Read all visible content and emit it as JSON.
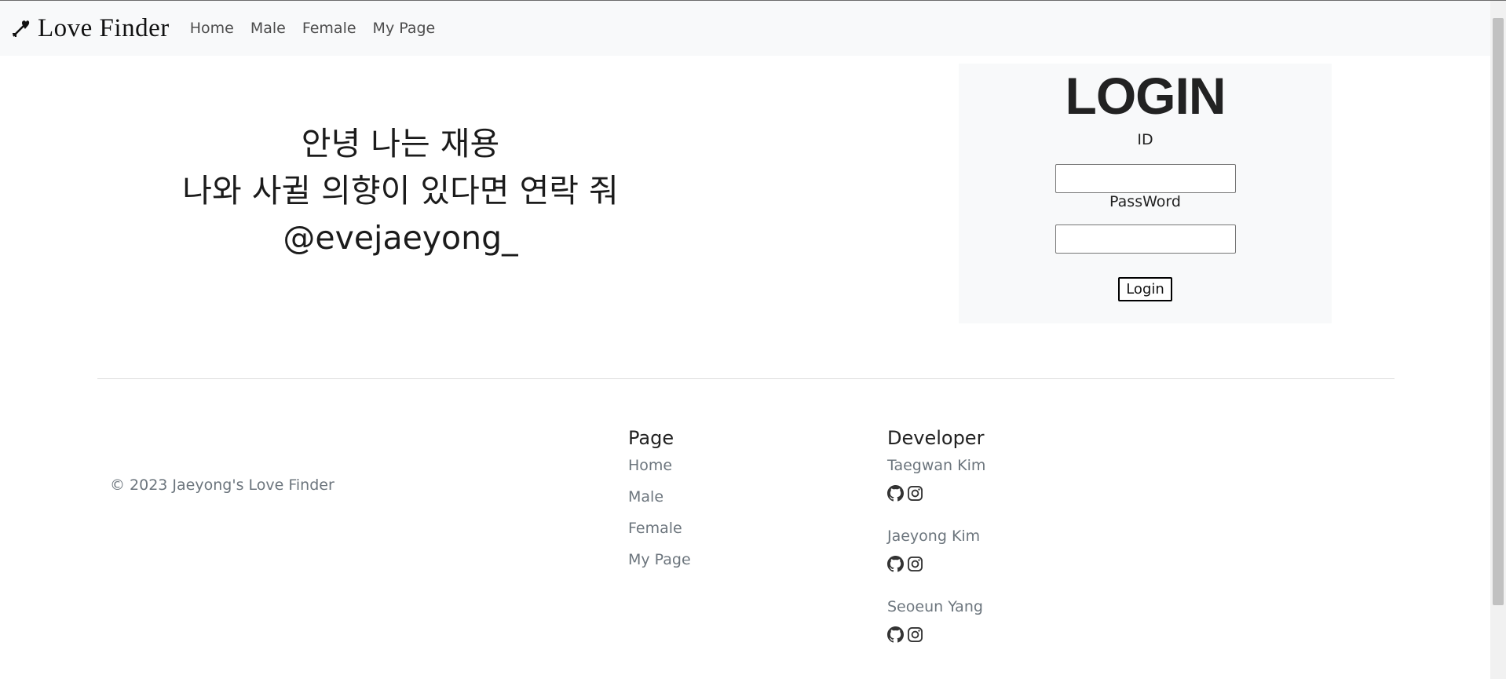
{
  "navbar": {
    "brand": "Love Finder",
    "links": [
      "Home",
      "Male",
      "Female",
      "My Page"
    ]
  },
  "hero": {
    "line1": "안녕 나는 재용",
    "line2": "나와 사귈 의향이 있다면 연락 줘",
    "line3": "@evejaeyong_"
  },
  "login": {
    "title": "LOGIN",
    "id_label": "ID",
    "id_value": "",
    "password_label": "PassWord",
    "password_value": "",
    "button": "Login"
  },
  "footer": {
    "copyright": "© 2023 Jaeyong's Love Finder",
    "page_heading": "Page",
    "page_links": [
      "Home",
      "Male",
      "Female",
      "My Page"
    ],
    "developer_heading": "Developer",
    "developers": [
      {
        "name": "Taegwan Kim",
        "icons": [
          "github-icon",
          "instagram-icon"
        ]
      },
      {
        "name": "Jaeyong Kim",
        "icons": [
          "github-icon",
          "instagram-icon"
        ]
      },
      {
        "name": "Seoeun Yang",
        "icons": [
          "github-icon",
          "instagram-icon"
        ]
      }
    ]
  },
  "colors": {
    "navbar_bg": "#f8f9fa",
    "panel_bg": "#f8f9fa",
    "muted_text": "#6c757d"
  }
}
